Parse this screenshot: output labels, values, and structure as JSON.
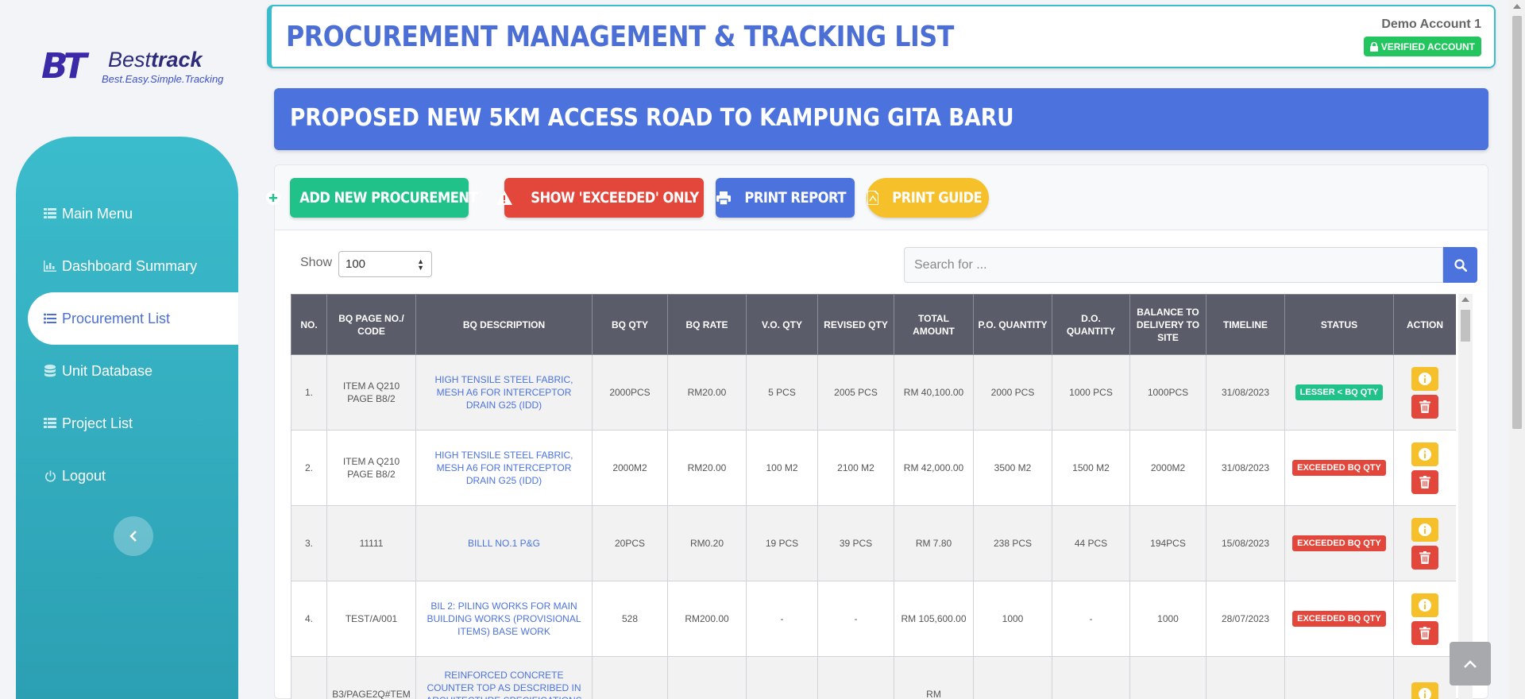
{
  "brand": {
    "mark": "BT",
    "name_plain": "Best",
    "name_bold": "track",
    "tagline": "Best.Easy.Simple.Tracking"
  },
  "sidebar": {
    "items": [
      {
        "label": "Main Menu",
        "icon": "grid-icon"
      },
      {
        "label": "Dashboard Summary",
        "icon": "chart-icon"
      },
      {
        "label": "Procurement List",
        "icon": "list-icon",
        "active": true
      },
      {
        "label": "Unit Database",
        "icon": "database-icon"
      },
      {
        "label": "Project List",
        "icon": "grid-icon"
      },
      {
        "label": "Logout",
        "icon": "power-icon"
      }
    ],
    "collapse_icon": "chevron-left-icon"
  },
  "header": {
    "title": "PROCUREMENT MANAGEMENT & TRACKING LIST",
    "account": "Demo Account 1",
    "verified": "VERIFIED ACCOUNT"
  },
  "project": {
    "title": "PROPOSED NEW 5KM ACCESS ROAD TO KAMPUNG GITA BARU"
  },
  "toolbar": {
    "add": "ADD NEW PROCUREMENT",
    "exceeded": "SHOW 'EXCEEDED' ONLY",
    "print": "PRINT REPORT",
    "guide": "PRINT GUIDE"
  },
  "controls": {
    "show_label": "Show",
    "show_value": "100",
    "search_placeholder": "Search for ..."
  },
  "table": {
    "columns": [
      "NO.",
      "BQ PAGE NO./ CODE",
      "BQ DESCRIPTION",
      "BQ QTY",
      "BQ RATE",
      "V.O. QTY",
      "REVISED QTY",
      "TOTAL AMOUNT",
      "P.O. QUANTITY",
      "D.O. QUANTITY",
      "BALANCE TO DELIVERY TO SITE",
      "TIMELINE",
      "STATUS",
      "ACTION"
    ],
    "rows": [
      {
        "no": "1.",
        "code": "ITEM A Q210 PAGE B8/2",
        "desc": "HIGH TENSILE STEEL FABRIC, MESH A6 FOR INTERCEPTOR DRAIN G25 (IDD)",
        "bq_qty": "2000PCS",
        "bq_rate": "RM20.00",
        "vo_qty": "5 PCS",
        "revised": "2005 PCS",
        "total": "RM 40,100.00",
        "po": "2000 PCS",
        "do": "1000 PCS",
        "balance": "1000PCS",
        "timeline": "31/08/2023",
        "status": "LESSER < BQ QTY",
        "status_type": "green"
      },
      {
        "no": "2.",
        "code": "ITEM A Q210 PAGE B8/2",
        "desc": "HIGH TENSILE STEEL FABRIC, MESH A6 FOR INTERCEPTOR DRAIN G25 (IDD)",
        "bq_qty": "2000M2",
        "bq_rate": "RM20.00",
        "vo_qty": "100 M2",
        "revised": "2100 M2",
        "total": "RM 42,000.00",
        "po": "3500 M2",
        "do": "1500 M2",
        "balance": "2000M2",
        "timeline": "31/08/2023",
        "status": "EXCEEDED BQ QTY",
        "status_type": "red"
      },
      {
        "no": "3.",
        "code": "11111",
        "desc": "BILLL NO.1 P&G",
        "bq_qty": "20PCS",
        "bq_rate": "RM0.20",
        "vo_qty": "19 PCS",
        "revised": "39 PCS",
        "total": "RM 7.80",
        "po": "238 PCS",
        "do": "44 PCS",
        "balance": "194PCS",
        "timeline": "15/08/2023",
        "status": "EXCEEDED BQ QTY",
        "status_type": "red"
      },
      {
        "no": "4.",
        "code": "TEST/A/001",
        "desc": "BIL 2: PILING WORKS FOR MAIN BUILDING WORKS (PROVISIONAL ITEMS) BASE WORK",
        "bq_qty": "528",
        "bq_rate": "RM200.00",
        "vo_qty": "-",
        "revised": "-",
        "total": "RM 105,600.00",
        "po": "1000",
        "do": "-",
        "balance": "1000",
        "timeline": "28/07/2023",
        "status": "EXCEEDED BQ QTY",
        "status_type": "red"
      },
      {
        "no": "",
        "code": "B3/PAGE2Q#TEM",
        "desc": "REINFORCED CONCRETE COUNTER TOP AS DESCRIBED IN ARCHITECTURE SPECIFICATIONS IN",
        "bq_qty": "",
        "bq_rate": "",
        "vo_qty": "",
        "revised": "",
        "total": "RM",
        "po": "",
        "do": "",
        "balance": "",
        "timeline": "",
        "status": "",
        "status_type": ""
      }
    ]
  },
  "back_to_top_icon": "chevron-up-icon"
}
